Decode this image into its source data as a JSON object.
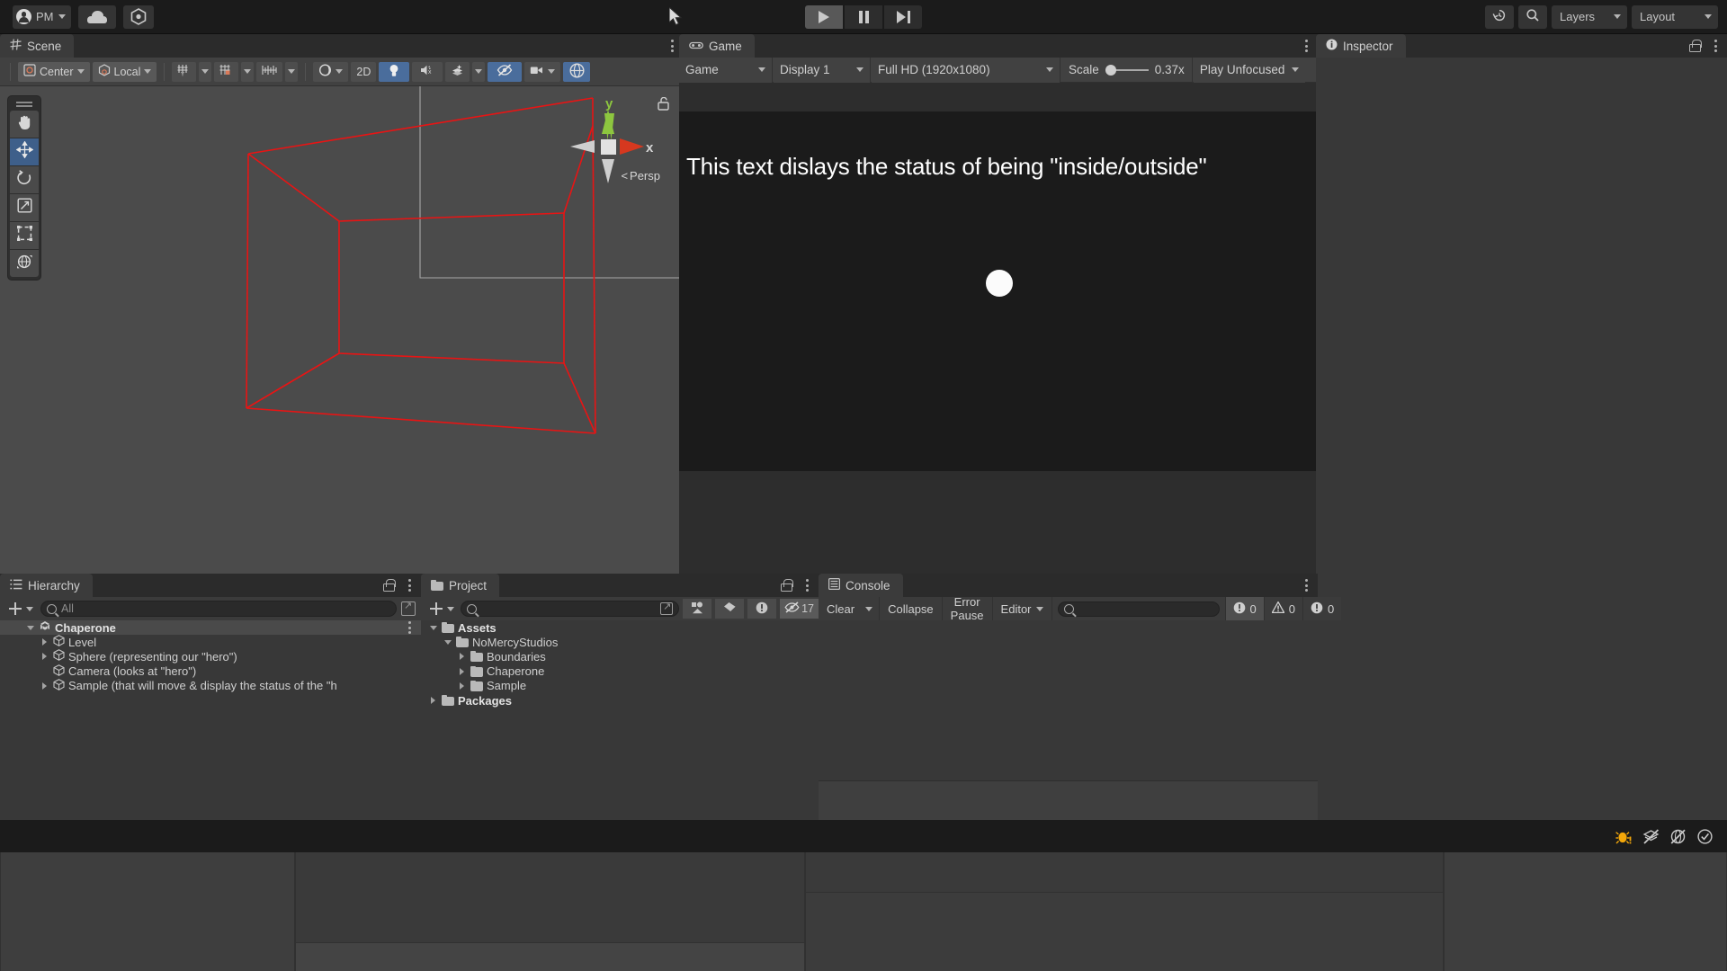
{
  "toolbar": {
    "account_label": "PM",
    "account_icon": "user-avatar-icon",
    "cloud_icon": "cloud-icon",
    "services_icon": "unity-services-icon",
    "play_icon": "play-icon",
    "pause_icon": "pause-icon",
    "step_icon": "step-icon",
    "undo_history_icon": "undo-history-icon",
    "search_icon": "search-icon",
    "layers_label": "Layers",
    "layout_label": "Layout"
  },
  "scene": {
    "tab_label": "Scene",
    "tab_icon": "scene-grid-icon",
    "pivot_label": "Center",
    "pivot_icon": "pivot-center-icon",
    "rotation_label": "Local",
    "rotation_icon": "handle-local-icon",
    "grid_icon": "grid-axis-icon",
    "snap_icon": "snap-increment-icon",
    "grid_size_icon": "grid-size-icon",
    "shading_icon": "shaded-mode-icon",
    "two_d_label": "2D",
    "lighting_icon": "light-bulb-icon",
    "audio_icon": "audio-mute-icon",
    "fx_icon": "effects-icon",
    "hidden_icon": "hidden-objects-icon",
    "camera_icon": "scene-camera-icon",
    "gizmos_icon": "gizmos-icon",
    "tools": [
      {
        "name": "hand-tool",
        "icon": "hand-icon",
        "selected": false
      },
      {
        "name": "move-tool",
        "icon": "move-icon",
        "selected": true
      },
      {
        "name": "rotate-tool",
        "icon": "rotate-icon",
        "selected": false
      },
      {
        "name": "scale-tool",
        "icon": "scale-icon",
        "selected": false
      },
      {
        "name": "rect-tool",
        "icon": "rect-transform-icon",
        "selected": false
      },
      {
        "name": "transform-tool",
        "icon": "combined-transform-icon",
        "selected": false
      }
    ],
    "gizmo": {
      "y_label": "y",
      "x_label": "x",
      "perspective_label": "Persp",
      "lock_icon": "lock-open-icon",
      "x_axis_color": "#d6381f",
      "y_axis_color": "#8dc63f"
    },
    "wireframe_color": "#e81414"
  },
  "game": {
    "tab_label": "Game",
    "tab_icon": "game-controller-icon",
    "view_label": "Game",
    "display_label": "Display 1",
    "resolution_label": "Full HD (1920x1080)",
    "scale_label": "Scale",
    "scale_value": "0.37x",
    "play_mode_label": "Play Unfocused",
    "status_text": "This text dislays the status of being \"inside/outside\"",
    "hero_object": "white-sphere",
    "background_color": "#1b1b1b"
  },
  "inspector": {
    "tab_label": "Inspector",
    "tab_icon": "info-circle-icon",
    "lock_icon": "lock-open-icon"
  },
  "hierarchy": {
    "tab_label": "Hierarchy",
    "tab_icon": "hierarchy-list-icon",
    "lock_icon": "lock-open-icon",
    "create_label": "+",
    "search_placeholder": "All",
    "search_value": "",
    "items": [
      {
        "label": "Chaperone",
        "depth": 0,
        "arrow": "open",
        "icon": "unity-scene-icon",
        "selected": true
      },
      {
        "label": "Level",
        "depth": 1,
        "arrow": "closed",
        "icon": "gameobject-cube-icon",
        "selected": false
      },
      {
        "label": "Sphere (representing our \"hero\")",
        "depth": 1,
        "arrow": "closed",
        "icon": "gameobject-cube-icon",
        "selected": false
      },
      {
        "label": "Camera (looks at \"hero\")",
        "depth": 1,
        "arrow": "none",
        "icon": "gameobject-cube-icon",
        "selected": false
      },
      {
        "label": "Sample (that will move & display the status of the \"h",
        "depth": 1,
        "arrow": "closed",
        "icon": "gameobject-cube-icon",
        "selected": false
      }
    ]
  },
  "project": {
    "tab_label": "Project",
    "tab_icon": "folder-icon",
    "lock_icon": "lock-open-icon",
    "search_placeholder": "",
    "search_value": "",
    "filter_icons": [
      "asset-type-filter-icon",
      "label-filter-icon",
      "warning-filter-icon"
    ],
    "hidden_count": "17",
    "hidden_count_icon": "hidden-eye-icon",
    "items": [
      {
        "label": "Assets",
        "depth": 0,
        "arrow": "open",
        "icon": "folder-open-icon",
        "bold": true
      },
      {
        "label": "NoMercyStudios",
        "depth": 1,
        "arrow": "open",
        "icon": "folder-open-icon",
        "bold": false
      },
      {
        "label": "Boundaries",
        "depth": 2,
        "arrow": "closed",
        "icon": "folder-icon",
        "bold": false
      },
      {
        "label": "Chaperone",
        "depth": 2,
        "arrow": "closed",
        "icon": "folder-icon",
        "bold": false
      },
      {
        "label": "Sample",
        "depth": 2,
        "arrow": "closed",
        "icon": "folder-icon",
        "bold": false
      },
      {
        "label": "Packages",
        "depth": 0,
        "arrow": "closed",
        "icon": "folder-icon",
        "bold": true
      }
    ]
  },
  "console": {
    "tab_label": "Console",
    "tab_icon": "console-lines-icon",
    "clear_label": "Clear",
    "collapse_label": "Collapse",
    "error_pause_label": "Error Pause",
    "editor_label": "Editor",
    "search_placeholder": "",
    "search_value": "",
    "log_count": "0",
    "warning_count": "0",
    "error_count": "0",
    "log_icon": "log-message-icon",
    "warning_icon": "warning-triangle-icon",
    "error_icon": "error-circle-icon"
  },
  "statusbar": {
    "icons": [
      {
        "name": "bug-warning-icon",
        "color": "#f3a70a"
      },
      {
        "name": "layers-disabled-icon",
        "color": "#c8c8c8"
      },
      {
        "name": "no-preview-icon",
        "color": "#c8c8c8"
      },
      {
        "name": "check-circle-icon",
        "color": "#c8c8c8"
      }
    ]
  }
}
